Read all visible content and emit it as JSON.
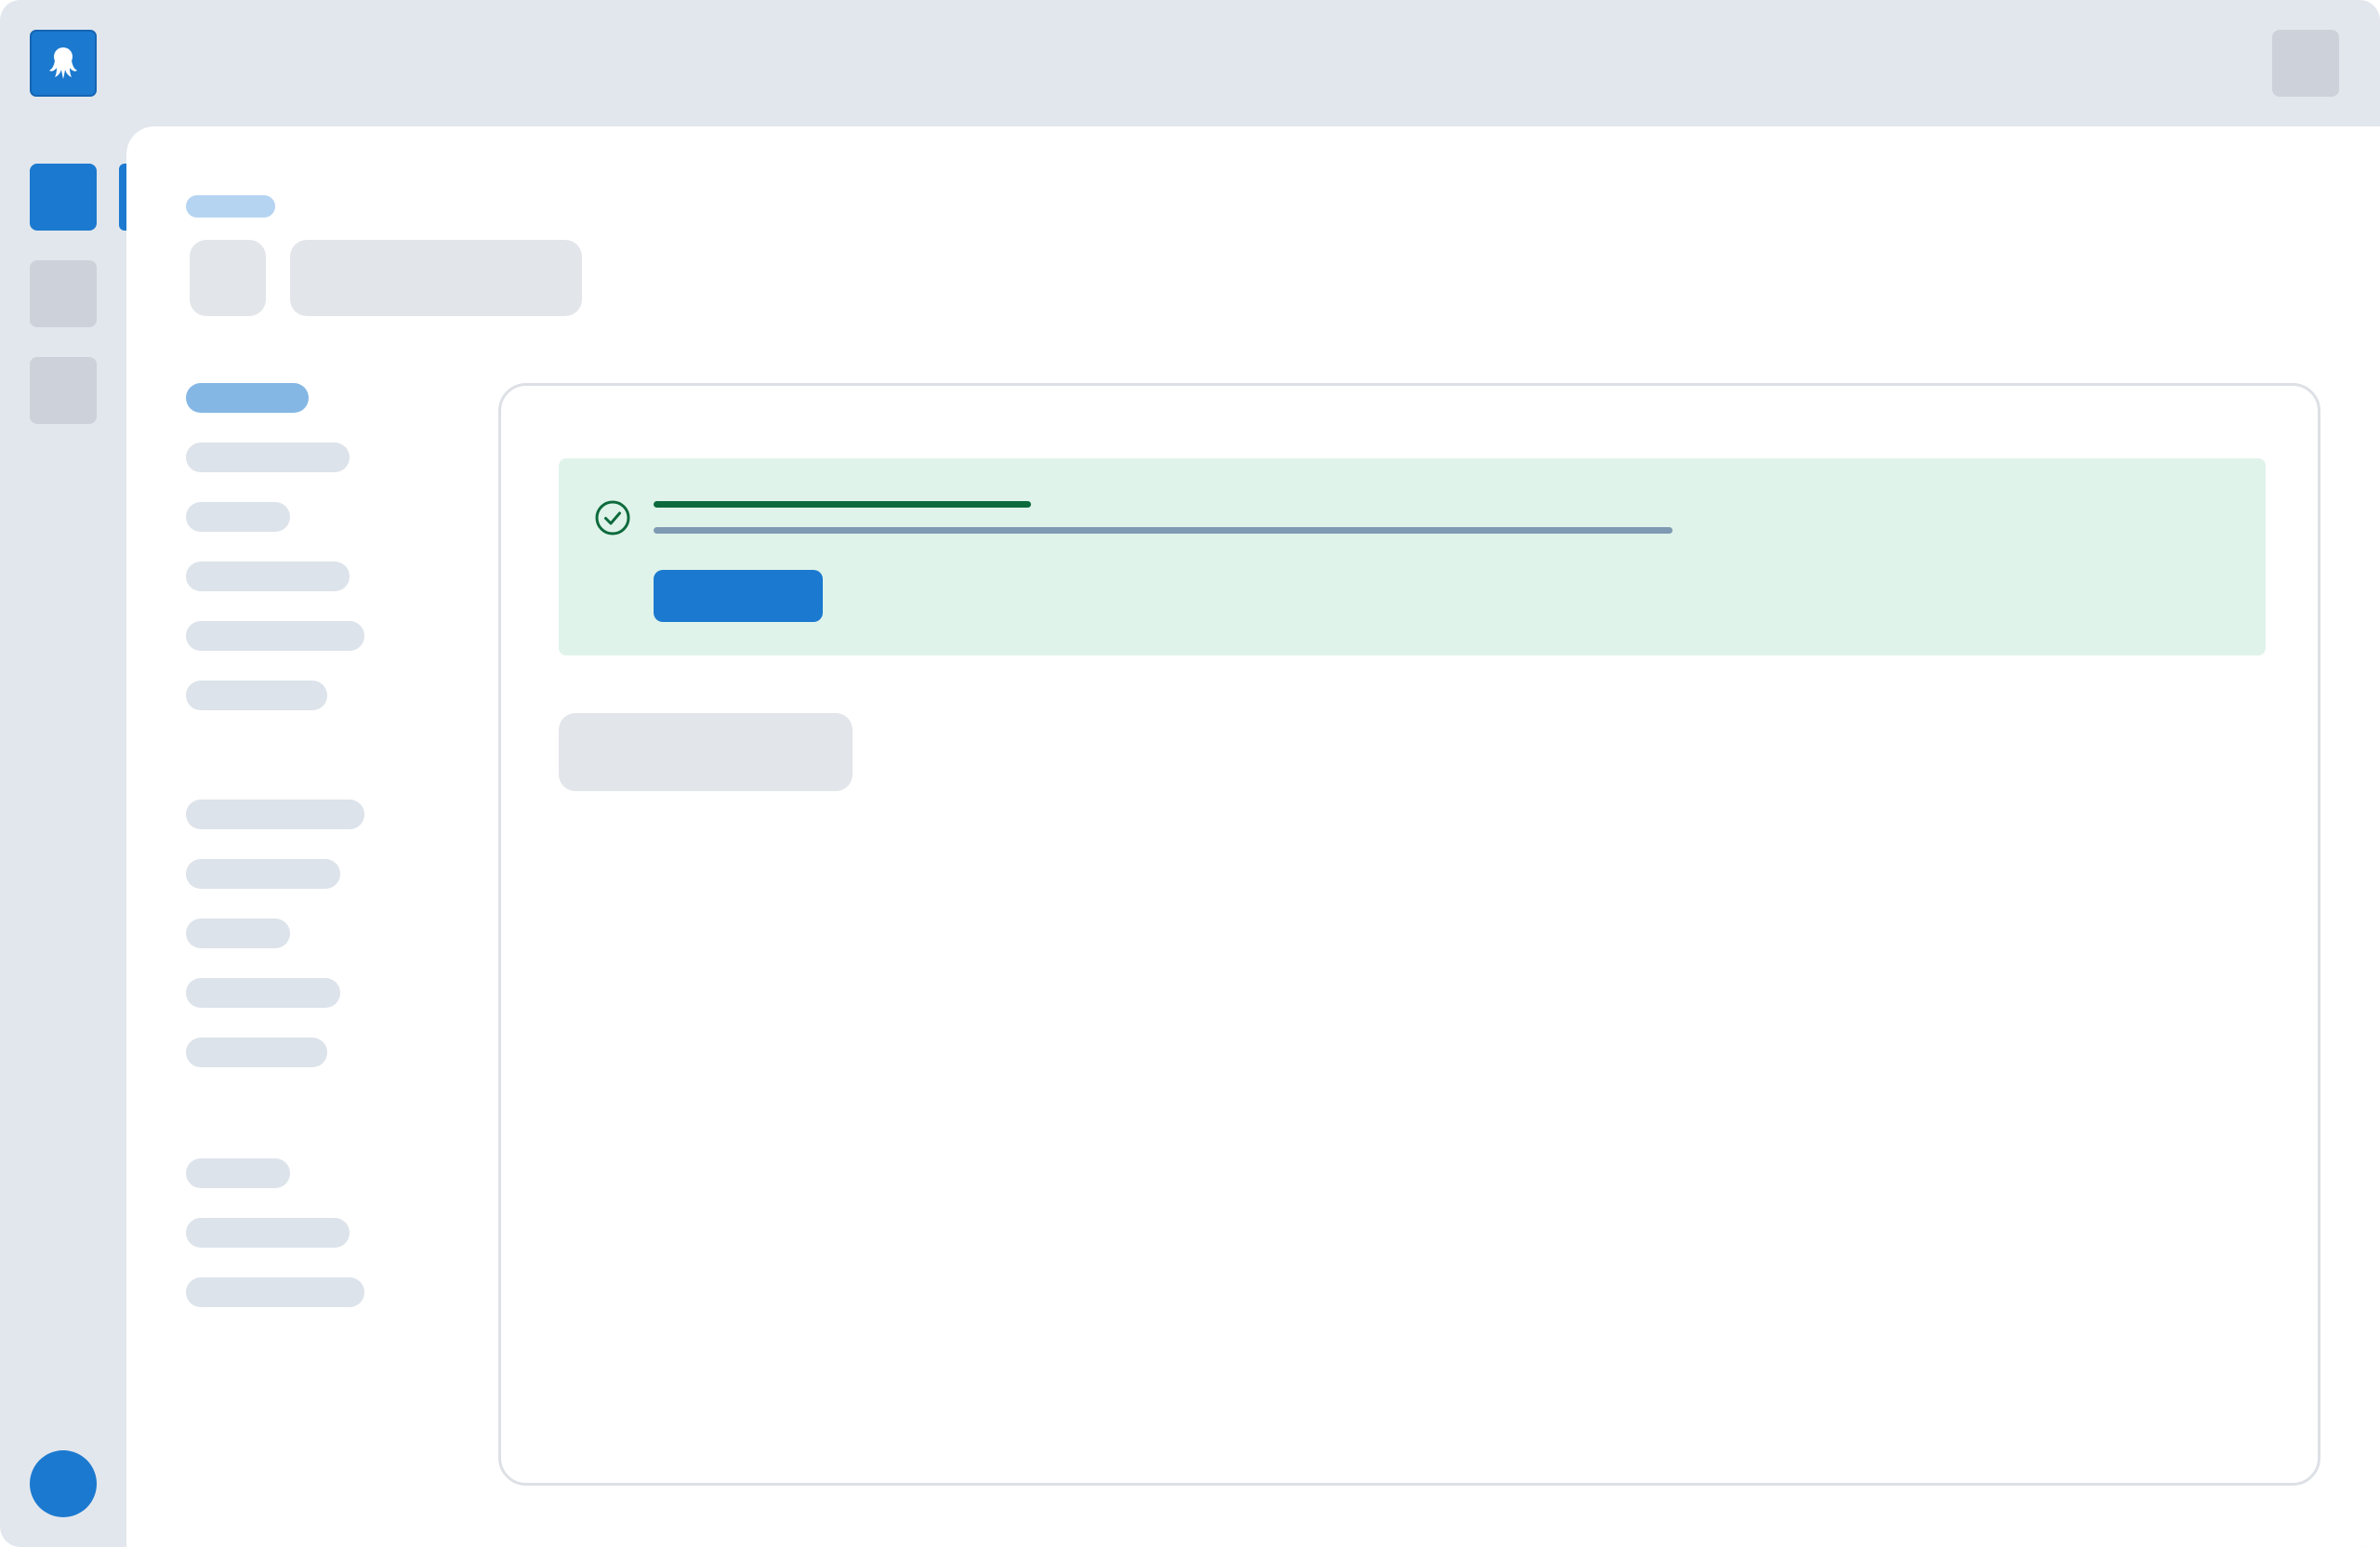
{
  "app": {
    "logo_icon": "octopus-logo-icon"
  },
  "colors": {
    "accent": "#1b79cf",
    "success_bg": "#dff3ea",
    "success_fg": "#0d6a3c",
    "skeleton": "#e2e5e9",
    "shell_bg": "#e2e7ed"
  },
  "sidebar_rail": {
    "items": [
      {
        "state": "active"
      },
      {
        "state": "inactive"
      },
      {
        "state": "inactive"
      }
    ],
    "avatar": {
      "color": "#1b79cf"
    }
  },
  "page": {
    "breadcrumb": "",
    "title": ""
  },
  "nav": {
    "groups": [
      {
        "items": [
          {
            "label": "",
            "active": true
          },
          {
            "label": ""
          },
          {
            "label": ""
          },
          {
            "label": ""
          },
          {
            "label": ""
          },
          {
            "label": ""
          }
        ]
      },
      {
        "items": [
          {
            "label": ""
          },
          {
            "label": ""
          },
          {
            "label": ""
          },
          {
            "label": ""
          },
          {
            "label": ""
          }
        ]
      },
      {
        "items": [
          {
            "label": ""
          },
          {
            "label": ""
          },
          {
            "label": ""
          }
        ]
      }
    ]
  },
  "alert": {
    "type": "success",
    "icon": "check-circle-icon",
    "title": "",
    "description": "",
    "action_label": ""
  },
  "secondary_action": {
    "label": ""
  }
}
